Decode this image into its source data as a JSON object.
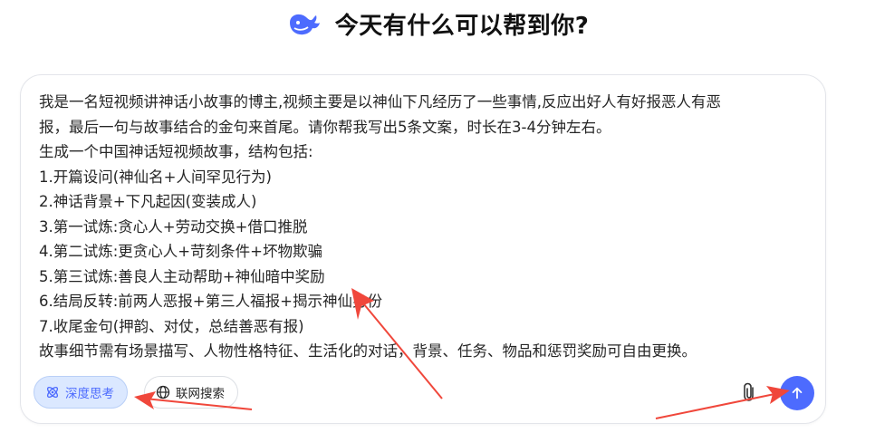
{
  "header": {
    "title": "今天有什么可以帮到你?",
    "logo_icon": "whale-logo-icon"
  },
  "composer": {
    "lines": [
      "我是一名短视频讲神话小故事的博主,视频主要是以神仙下凡经历了一些事情,反应出好人有好报恶人有恶",
      "报，最后一句与故事结合的金句来首尾。请你帮我写出5条文案，时长在3-4分钟左右。",
      "生成一个中国神话短视频故事，结构包括:",
      "1.开篇设问(神仙名+人间罕见行为)",
      "2.神话背景+下凡起因(变装成人)",
      "3.第一试炼:贪心人+劳动交换+借口推脱",
      "4.第二试炼:更贪心人+苛刻条件+坏物欺骗",
      "5.第三试炼:善良人主动帮助+神仙暗中奖励",
      "6.结局反转:前两人恶报+第三人福报+揭示神仙身份",
      "7.收尾金句(押韵、对仗，总结善恶有报)",
      "故事细节需有场景描写、人物性格特征、生活化的对话，背景、任务、物品和惩罚奖励可自由更换。"
    ]
  },
  "toolbar": {
    "deep_think_label": "深度思考",
    "deep_think_icon": "atom-icon",
    "web_search_label": "联网搜索",
    "web_search_icon": "globe-icon",
    "attach_icon": "paperclip-icon",
    "send_icon": "arrow-up-icon"
  },
  "colors": {
    "accent": "#4d6bfe",
    "annotation_arrow": "#f0473b"
  }
}
